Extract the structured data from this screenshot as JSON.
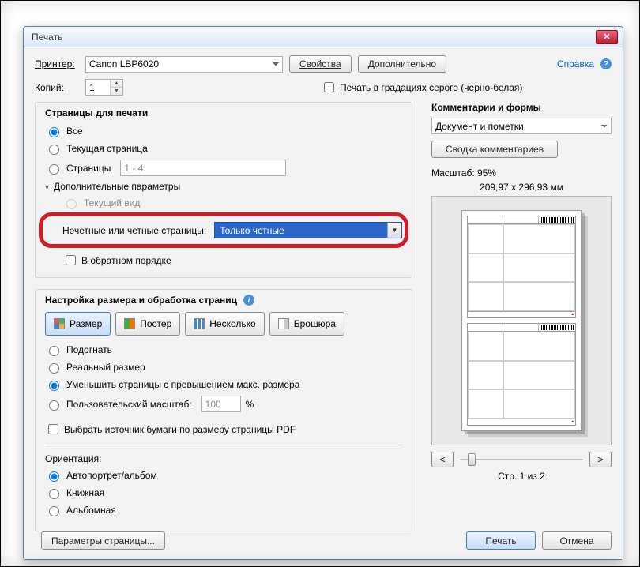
{
  "window": {
    "title": "Печать"
  },
  "help_link": "Справка",
  "printer": {
    "label": "Принтер:",
    "value": "Canon LBP6020",
    "properties_btn": "Свойства",
    "advanced_btn": "Дополнительно"
  },
  "copies": {
    "label": "Копий:",
    "value": "1"
  },
  "grayscale": {
    "label": "Печать в градациях серого (черно-белая)"
  },
  "pages_group": {
    "title": "Страницы для печати",
    "all": "Все",
    "current": "Текущая страница",
    "range_label": "Страницы",
    "range_value": "1 - 4",
    "more": "Дополнительные параметры",
    "current_view": "Текущий вид",
    "odd_even_label": "Нечетные или четные страницы:",
    "odd_even_value": "Только четные",
    "reverse": "В обратном порядке"
  },
  "sizing_group": {
    "title": "Настройка размера и обработка страниц",
    "size": "Размер",
    "poster": "Постер",
    "multiple": "Несколько",
    "booklet": "Брошюра",
    "fit": "Подогнать",
    "actual": "Реальный размер",
    "shrink": "Уменьшить страницы с превышением макс. размера",
    "custom": "Пользовательский масштаб:",
    "custom_value": "100",
    "custom_pct": "%",
    "source": "Выбрать источник бумаги по размеру страницы PDF"
  },
  "orientation": {
    "title": "Ориентация:",
    "auto": "Автопортрет/альбом",
    "portrait": "Книжная",
    "landscape": "Альбомная"
  },
  "comments_group": {
    "title": "Комментарии и формы",
    "value": "Документ и пометки",
    "summary_btn": "Сводка комментариев"
  },
  "preview": {
    "scale_label": "Масштаб: 95%",
    "dims": "209,97 x 296,93 мм",
    "page_of": "Стр. 1 из 2",
    "prev": "<",
    "next": ">"
  },
  "footer": {
    "page_setup": "Параметры страницы...",
    "print": "Печать",
    "cancel": "Отмена"
  }
}
